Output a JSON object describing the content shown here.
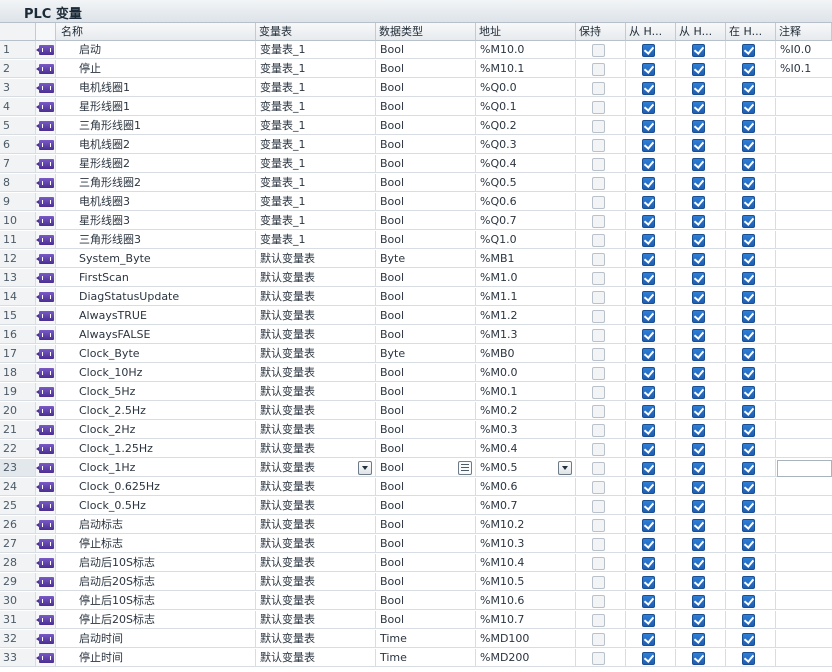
{
  "editor_title": "PLC 变量",
  "columns": {
    "name": "名称",
    "table": "变量表",
    "type": "数据类型",
    "address": "地址",
    "retain": "保持",
    "from_hmi_1": "从 H...",
    "from_hmi_2": "从 H...",
    "in_hmi": "在 H...",
    "comment": "注释"
  },
  "colors": {
    "checkbox_checked": "#1d5fb3",
    "tag_icon": "#5a3aa8",
    "header_bg": "#e6eaee"
  },
  "active_row": 23,
  "rows": [
    {
      "idx": "1",
      "name": "启动",
      "table": "变量表_1",
      "type": "Bool",
      "address": "%M10.0",
      "comment": "%I0.0"
    },
    {
      "idx": "2",
      "name": "停止",
      "table": "变量表_1",
      "type": "Bool",
      "address": "%M10.1",
      "comment": "%I0.1"
    },
    {
      "idx": "3",
      "name": "电机线圈1",
      "table": "变量表_1",
      "type": "Bool",
      "address": "%Q0.0",
      "comment": ""
    },
    {
      "idx": "4",
      "name": "星形线圈1",
      "table": "变量表_1",
      "type": "Bool",
      "address": "%Q0.1",
      "comment": ""
    },
    {
      "idx": "5",
      "name": "三角形线圈1",
      "table": "变量表_1",
      "type": "Bool",
      "address": "%Q0.2",
      "comment": ""
    },
    {
      "idx": "6",
      "name": "电机线圈2",
      "table": "变量表_1",
      "type": "Bool",
      "address": "%Q0.3",
      "comment": ""
    },
    {
      "idx": "7",
      "name": "星形线圈2",
      "table": "变量表_1",
      "type": "Bool",
      "address": "%Q0.4",
      "comment": ""
    },
    {
      "idx": "8",
      "name": "三角形线圈2",
      "table": "变量表_1",
      "type": "Bool",
      "address": "%Q0.5",
      "comment": ""
    },
    {
      "idx": "9",
      "name": "电机线圈3",
      "table": "变量表_1",
      "type": "Bool",
      "address": "%Q0.6",
      "comment": ""
    },
    {
      "idx": "10",
      "name": "星形线圈3",
      "table": "变量表_1",
      "type": "Bool",
      "address": "%Q0.7",
      "comment": ""
    },
    {
      "idx": "11",
      "name": "三角形线圈3",
      "table": "变量表_1",
      "type": "Bool",
      "address": "%Q1.0",
      "comment": ""
    },
    {
      "idx": "12",
      "name": "System_Byte",
      "table": "默认变量表",
      "type": "Byte",
      "address": "%MB1",
      "comment": ""
    },
    {
      "idx": "13",
      "name": "FirstScan",
      "table": "默认变量表",
      "type": "Bool",
      "address": "%M1.0",
      "comment": ""
    },
    {
      "idx": "14",
      "name": "DiagStatusUpdate",
      "table": "默认变量表",
      "type": "Bool",
      "address": "%M1.1",
      "comment": ""
    },
    {
      "idx": "15",
      "name": "AlwaysTRUE",
      "table": "默认变量表",
      "type": "Bool",
      "address": "%M1.2",
      "comment": ""
    },
    {
      "idx": "16",
      "name": "AlwaysFALSE",
      "table": "默认变量表",
      "type": "Bool",
      "address": "%M1.3",
      "comment": ""
    },
    {
      "idx": "17",
      "name": "Clock_Byte",
      "table": "默认变量表",
      "type": "Byte",
      "address": "%MB0",
      "comment": ""
    },
    {
      "idx": "18",
      "name": "Clock_10Hz",
      "table": "默认变量表",
      "type": "Bool",
      "address": "%M0.0",
      "comment": ""
    },
    {
      "idx": "19",
      "name": "Clock_5Hz",
      "table": "默认变量表",
      "type": "Bool",
      "address": "%M0.1",
      "comment": ""
    },
    {
      "idx": "20",
      "name": "Clock_2.5Hz",
      "table": "默认变量表",
      "type": "Bool",
      "address": "%M0.2",
      "comment": ""
    },
    {
      "idx": "21",
      "name": "Clock_2Hz",
      "table": "默认变量表",
      "type": "Bool",
      "address": "%M0.3",
      "comment": ""
    },
    {
      "idx": "22",
      "name": "Clock_1.25Hz",
      "table": "默认变量表",
      "type": "Bool",
      "address": "%M0.4",
      "comment": ""
    },
    {
      "idx": "23",
      "name": "Clock_1Hz",
      "table": "默认变量表",
      "type": "Bool",
      "address": "%M0.5",
      "comment": ""
    },
    {
      "idx": "24",
      "name": "Clock_0.625Hz",
      "table": "默认变量表",
      "type": "Bool",
      "address": "%M0.6",
      "comment": ""
    },
    {
      "idx": "25",
      "name": "Clock_0.5Hz",
      "table": "默认变量表",
      "type": "Bool",
      "address": "%M0.7",
      "comment": ""
    },
    {
      "idx": "26",
      "name": "启动标志",
      "table": "默认变量表",
      "type": "Bool",
      "address": "%M10.2",
      "comment": ""
    },
    {
      "idx": "27",
      "name": "停止标志",
      "table": "默认变量表",
      "type": "Bool",
      "address": "%M10.3",
      "comment": ""
    },
    {
      "idx": "28",
      "name": "启动后10S标志",
      "table": "默认变量表",
      "type": "Bool",
      "address": "%M10.4",
      "comment": ""
    },
    {
      "idx": "29",
      "name": "启动后20S标志",
      "table": "默认变量表",
      "type": "Bool",
      "address": "%M10.5",
      "comment": ""
    },
    {
      "idx": "30",
      "name": "停止后10S标志",
      "table": "默认变量表",
      "type": "Bool",
      "address": "%M10.6",
      "comment": ""
    },
    {
      "idx": "31",
      "name": "停止后20S标志",
      "table": "默认变量表",
      "type": "Bool",
      "address": "%M10.7",
      "comment": ""
    },
    {
      "idx": "32",
      "name": "启动时间",
      "table": "默认变量表",
      "type": "Time",
      "address": "%MD100",
      "comment": ""
    },
    {
      "idx": "33",
      "name": "停止时间",
      "table": "默认变量表",
      "type": "Time",
      "address": "%MD200",
      "comment": ""
    }
  ]
}
